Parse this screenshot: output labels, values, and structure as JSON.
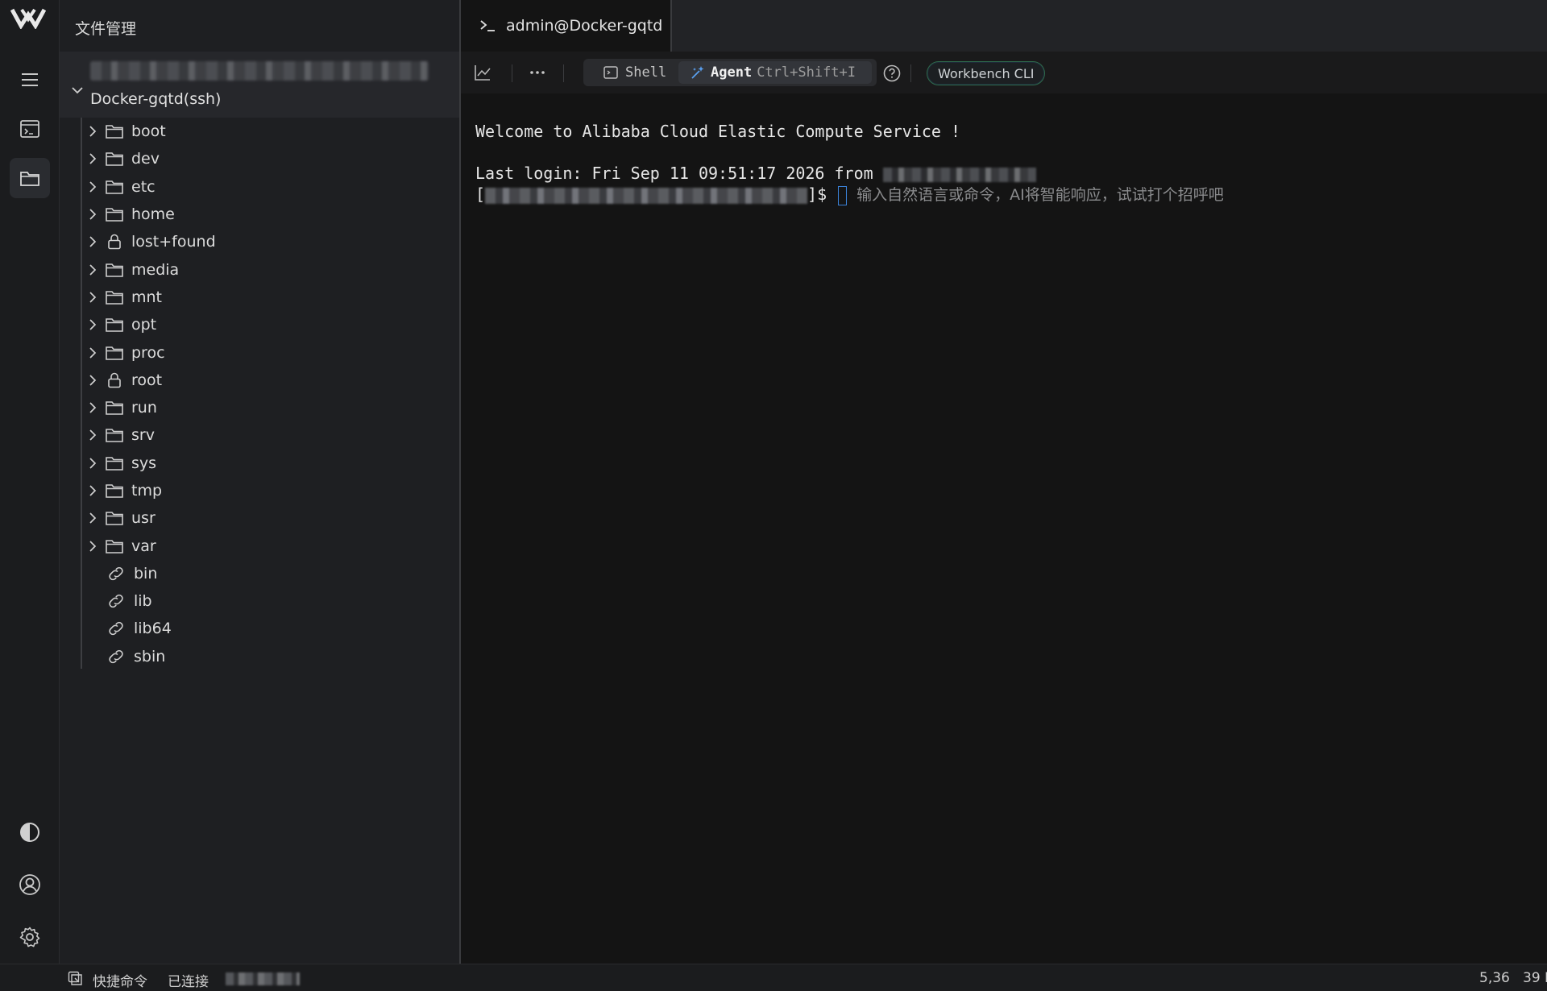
{
  "sidebar": {
    "title": "文件管理",
    "host": "Docker-gqtd(ssh)",
    "tree": [
      {
        "name": "boot",
        "type": "folder"
      },
      {
        "name": "dev",
        "type": "folder"
      },
      {
        "name": "etc",
        "type": "folder"
      },
      {
        "name": "home",
        "type": "folder"
      },
      {
        "name": "lost+found",
        "type": "locked"
      },
      {
        "name": "media",
        "type": "folder"
      },
      {
        "name": "mnt",
        "type": "folder"
      },
      {
        "name": "opt",
        "type": "folder"
      },
      {
        "name": "proc",
        "type": "folder"
      },
      {
        "name": "root",
        "type": "locked"
      },
      {
        "name": "run",
        "type": "folder"
      },
      {
        "name": "srv",
        "type": "folder"
      },
      {
        "name": "sys",
        "type": "folder"
      },
      {
        "name": "tmp",
        "type": "folder"
      },
      {
        "name": "usr",
        "type": "folder"
      },
      {
        "name": "var",
        "type": "folder"
      },
      {
        "name": "bin",
        "type": "symlink"
      },
      {
        "name": "lib",
        "type": "symlink"
      },
      {
        "name": "lib64",
        "type": "symlink"
      },
      {
        "name": "sbin",
        "type": "symlink"
      }
    ]
  },
  "tabs": [
    {
      "label": "admin@Docker-gqtd",
      "icon": "terminal-prompt-icon",
      "active": true
    }
  ],
  "toolbar": {
    "shell_label": "Shell",
    "agent_label": "Agent",
    "agent_shortcut": "Ctrl+Shift+I",
    "workbench_label": "Workbench CLI"
  },
  "terminal": {
    "welcome": "Welcome to Alibaba Cloud Elastic Compute Service !",
    "last_login": "Last login: Fri Sep 11 09:51:17 2026 from ",
    "prompt_open": "[",
    "prompt_close": "]$",
    "hint": "输入自然语言或命令，AI将智能响应，试试打个招呼吧"
  },
  "statusbar": {
    "quick_commands": "快捷命令",
    "connection": "已连接",
    "cursor_position": "5,36",
    "trailing": "39 I"
  },
  "colors": {
    "accent_blue": "#3b82d8",
    "workbench_border": "#2f6b4c",
    "background": "#141414",
    "sidebar": "#1e1f22"
  }
}
